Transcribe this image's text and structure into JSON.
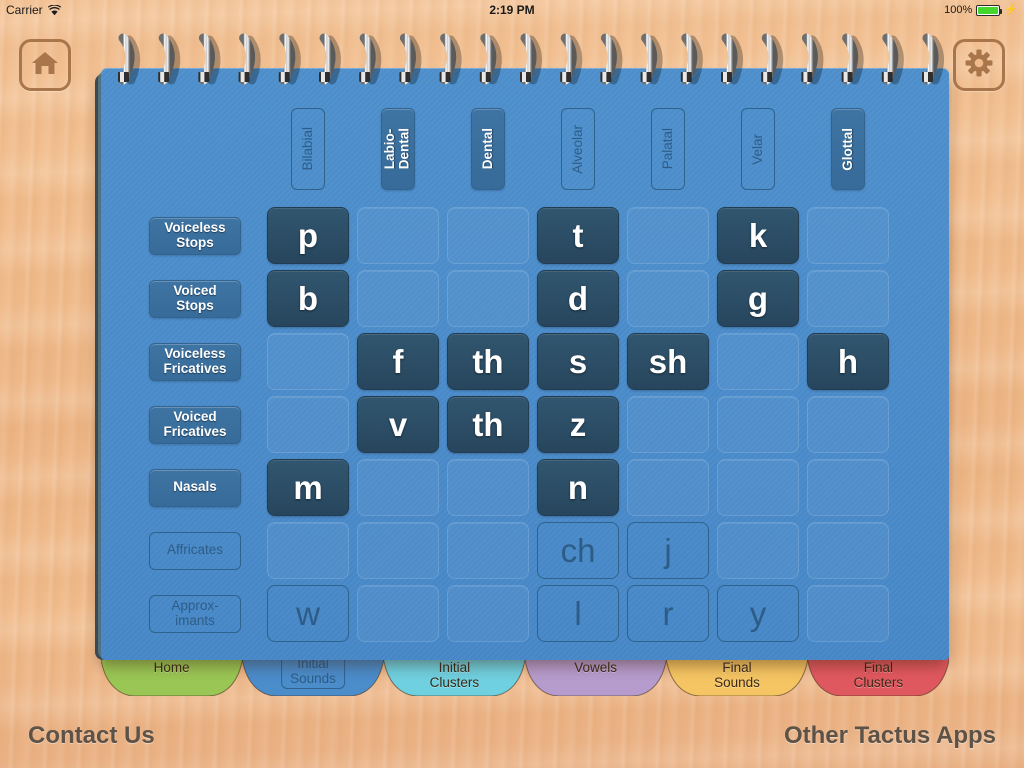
{
  "statusbar": {
    "carrier": "Carrier",
    "wifi_icon": "wifi-icon",
    "time": "2:19 PM",
    "battery_percent": "100%",
    "battery_icon": "battery-full-icon",
    "charging_icon": "lightning-bolt-icon"
  },
  "topbar": {
    "home_button": "home-icon",
    "settings_button": "gear-icon"
  },
  "colors": {
    "page": "#4b8ccb",
    "active_cell": "#2b4b63",
    "label_on": "#3a6f9e",
    "outline": "#2f628c",
    "wood": "#f0bb8c",
    "tab_home": "#9ac655",
    "tab_initial_clusters": "#6fd0e0",
    "tab_vowels": "#b59ccd",
    "tab_final_sounds": "#f5c563",
    "tab_final_clusters": "#e0585f"
  },
  "grid": {
    "columns": [
      {
        "label": "Bilabial",
        "state": "off"
      },
      {
        "label": "Labio-\nDental",
        "state": "on"
      },
      {
        "label": "Dental",
        "state": "on"
      },
      {
        "label": "Alveolar",
        "state": "off"
      },
      {
        "label": "Palatal",
        "state": "off"
      },
      {
        "label": "Velar",
        "state": "off"
      },
      {
        "label": "Glottal",
        "state": "on"
      }
    ],
    "rows": [
      {
        "label": "Voiceless\nStops",
        "state": "on",
        "cells": [
          {
            "text": "p",
            "state": "active"
          },
          {
            "text": "",
            "state": "empty"
          },
          {
            "text": "",
            "state": "empty"
          },
          {
            "text": "t",
            "state": "active"
          },
          {
            "text": "",
            "state": "empty"
          },
          {
            "text": "k",
            "state": "active"
          },
          {
            "text": "",
            "state": "empty"
          }
        ]
      },
      {
        "label": "Voiced\nStops",
        "state": "on",
        "cells": [
          {
            "text": "b",
            "state": "active"
          },
          {
            "text": "",
            "state": "empty"
          },
          {
            "text": "",
            "state": "empty"
          },
          {
            "text": "d",
            "state": "active"
          },
          {
            "text": "",
            "state": "empty"
          },
          {
            "text": "g",
            "state": "active"
          },
          {
            "text": "",
            "state": "empty"
          }
        ]
      },
      {
        "label": "Voiceless\nFricatives",
        "state": "on",
        "cells": [
          {
            "text": "",
            "state": "empty"
          },
          {
            "text": "f",
            "state": "active"
          },
          {
            "text": "th",
            "state": "active"
          },
          {
            "text": "s",
            "state": "active"
          },
          {
            "text": "sh",
            "state": "active"
          },
          {
            "text": "",
            "state": "empty"
          },
          {
            "text": "h",
            "state": "active"
          }
        ]
      },
      {
        "label": "Voiced\nFricatives",
        "state": "on",
        "cells": [
          {
            "text": "",
            "state": "empty"
          },
          {
            "text": "v",
            "state": "active"
          },
          {
            "text": "th",
            "state": "active"
          },
          {
            "text": "z",
            "state": "active"
          },
          {
            "text": "",
            "state": "empty"
          },
          {
            "text": "",
            "state": "empty"
          },
          {
            "text": "",
            "state": "empty"
          }
        ]
      },
      {
        "label": "Nasals",
        "state": "on",
        "cells": [
          {
            "text": "m",
            "state": "active"
          },
          {
            "text": "",
            "state": "empty"
          },
          {
            "text": "",
            "state": "empty"
          },
          {
            "text": "n",
            "state": "active"
          },
          {
            "text": "",
            "state": "empty"
          },
          {
            "text": "",
            "state": "empty"
          },
          {
            "text": "",
            "state": "empty"
          }
        ]
      },
      {
        "label": "Affricates",
        "state": "off",
        "cells": [
          {
            "text": "",
            "state": "empty"
          },
          {
            "text": "",
            "state": "empty"
          },
          {
            "text": "",
            "state": "empty"
          },
          {
            "text": "ch",
            "state": "disabled"
          },
          {
            "text": "j",
            "state": "disabled"
          },
          {
            "text": "",
            "state": "empty"
          },
          {
            "text": "",
            "state": "empty"
          }
        ]
      },
      {
        "label": "Approx-\nimants",
        "state": "off",
        "cells": [
          {
            "text": "w",
            "state": "disabled"
          },
          {
            "text": "",
            "state": "empty"
          },
          {
            "text": "",
            "state": "empty"
          },
          {
            "text": "l",
            "state": "disabled"
          },
          {
            "text": "r",
            "state": "disabled"
          },
          {
            "text": "y",
            "state": "disabled"
          },
          {
            "text": "",
            "state": "empty"
          }
        ]
      }
    ]
  },
  "tabs": [
    {
      "label": "Home",
      "color": "#9ac655",
      "selected": false
    },
    {
      "label": "Initial\nSounds",
      "color": "#4b8ccb",
      "selected": true
    },
    {
      "label": "Initial\nClusters",
      "color": "#6fd0e0",
      "selected": false
    },
    {
      "label": "Vowels",
      "color": "#b59ccd",
      "selected": false
    },
    {
      "label": "Final\nSounds",
      "color": "#f5c563",
      "selected": false
    },
    {
      "label": "Final\nClusters",
      "color": "#e0585f",
      "selected": false
    }
  ],
  "footer": {
    "contact": "Contact Us",
    "other_apps": "Other Tactus Apps"
  }
}
